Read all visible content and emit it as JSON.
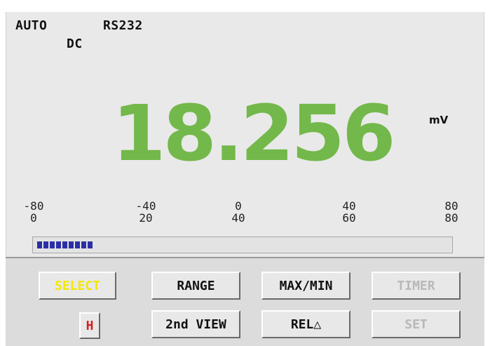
{
  "status": {
    "mode": "AUTO",
    "interface": "RS232",
    "coupling": "DC"
  },
  "display": {
    "reading": "18.256",
    "unit": "mV"
  },
  "scale": {
    "top": [
      "-80",
      "-40",
      "0",
      "40",
      "80"
    ],
    "bottom": [
      "0",
      "20",
      "40",
      "60",
      "80"
    ]
  },
  "bargraph": {
    "segments_lit": 9,
    "fraction": 0.2
  },
  "buttons": {
    "select": "SELECT",
    "range": "RANGE",
    "maxmin": "MAX/MIN",
    "timer": "TIMER",
    "hold": "H",
    "second_view": "2nd VIEW",
    "rel": "REL△",
    "set": "SET"
  },
  "colors": {
    "reading": "#73b84a",
    "bar": "#2b2fa6",
    "select_text": "#f2e800",
    "hold_text": "#d42020"
  }
}
